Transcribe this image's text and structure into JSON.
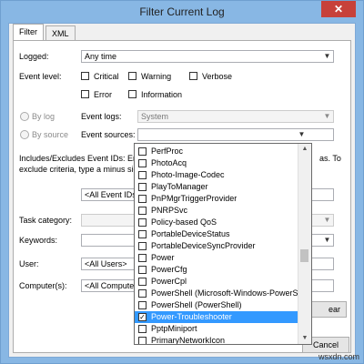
{
  "window": {
    "title": "Filter Current Log",
    "close_glyph": "✕"
  },
  "tabs": [
    "Filter",
    "XML"
  ],
  "logged": {
    "label": "Logged:",
    "value": "Any time"
  },
  "event_level": {
    "label": "Event level:",
    "options": [
      {
        "label": "Critical",
        "checked": false
      },
      {
        "label": "Warning",
        "checked": false
      },
      {
        "label": "Verbose",
        "checked": false
      },
      {
        "label": "Error",
        "checked": false
      },
      {
        "label": "Information",
        "checked": false
      }
    ]
  },
  "by_log": {
    "label": "By log",
    "logs_label": "Event logs:",
    "logs_value": "System"
  },
  "by_source": {
    "label": "By source",
    "sources_label": "Event sources:"
  },
  "event_ids": {
    "text_line1": "Includes/Excludes Event IDs: Enter",
    "text_line1_tail": "as. To",
    "text_line2": "exclude criteria, type a minus sign",
    "placeholder": "<All Event IDs>"
  },
  "task_category": {
    "label": "Task category:"
  },
  "keywords": {
    "label": "Keywords:"
  },
  "user": {
    "label": "User:",
    "value": "<All Users>"
  },
  "computer": {
    "label": "Computer(s):",
    "value": "<All Computers"
  },
  "buttons": {
    "clear": "ear",
    "cancel": "Cancel"
  },
  "dropdown": {
    "items": [
      {
        "label": "PerfProc",
        "checked": false
      },
      {
        "label": "PhotoAcq",
        "checked": false
      },
      {
        "label": "Photo-Image-Codec",
        "checked": false
      },
      {
        "label": "PlayToManager",
        "checked": false
      },
      {
        "label": "PnPMgrTriggerProvider",
        "checked": false
      },
      {
        "label": "PNRPSvc",
        "checked": false
      },
      {
        "label": "Policy-based QoS",
        "checked": false
      },
      {
        "label": "PortableDeviceStatus",
        "checked": false
      },
      {
        "label": "PortableDeviceSyncProvider",
        "checked": false
      },
      {
        "label": "Power",
        "checked": false
      },
      {
        "label": "PowerCfg",
        "checked": false
      },
      {
        "label": "PowerCpl",
        "checked": false
      },
      {
        "label": "PowerShell (Microsoft-Windows-PowerShe",
        "checked": false
      },
      {
        "label": "PowerShell (PowerShell)",
        "checked": false
      },
      {
        "label": "Power-Troubleshooter",
        "checked": true,
        "selected": true
      },
      {
        "label": "PptpMiniport",
        "checked": false
      },
      {
        "label": "PrimaryNetworkIcon",
        "checked": false
      }
    ]
  },
  "watermark": "wsxdn.com"
}
